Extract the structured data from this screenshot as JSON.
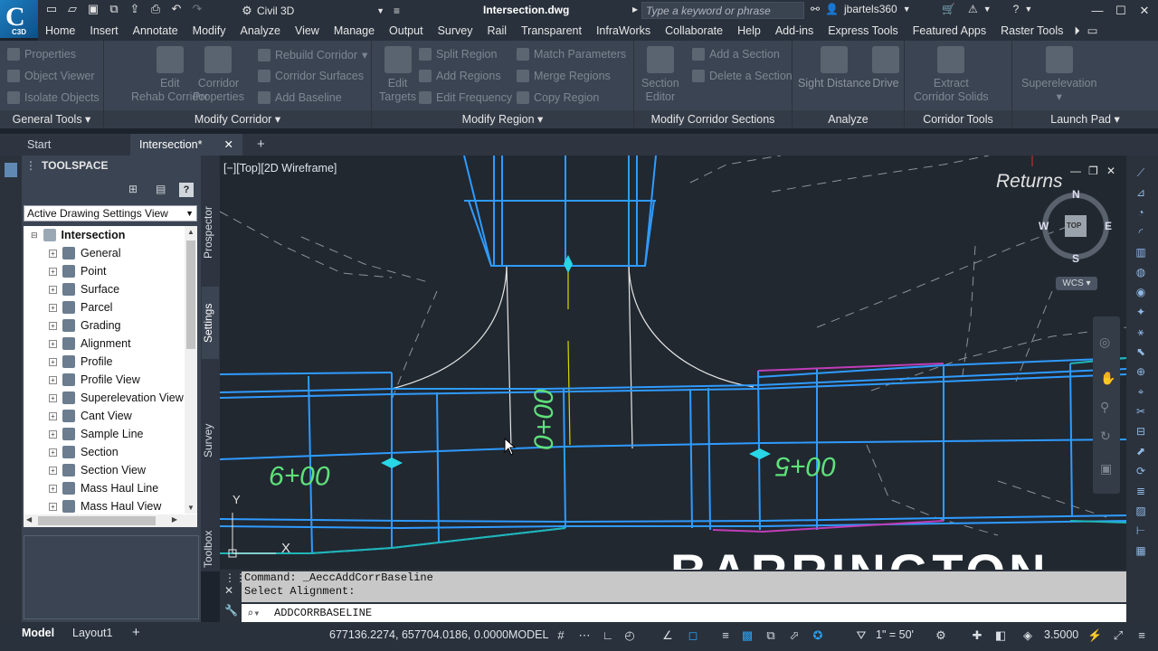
{
  "app": {
    "logo_text": "C",
    "logo_sub": "C3D",
    "workspace": "Civil 3D",
    "document_title": "Intersection.dwg"
  },
  "search": {
    "placeholder": "Type a keyword or phrase"
  },
  "user": {
    "name": "jbartels360"
  },
  "ribbon_tabs": [
    "Home",
    "Insert",
    "Annotate",
    "Modify",
    "Analyze",
    "View",
    "Manage",
    "Output",
    "Survey",
    "Rail",
    "Transparent",
    "InfraWorks",
    "Collaborate",
    "Help",
    "Add-ins",
    "Express Tools",
    "Featured Apps",
    "Raster Tools"
  ],
  "ribbon": {
    "general_tools": {
      "title": "General Tools",
      "properties": "Properties",
      "object_viewer": "Object Viewer",
      "isolate_objects": "Isolate Objects"
    },
    "modify_corridor": {
      "title": "Modify Corridor",
      "edit_rehab_l1": "Edit",
      "edit_rehab_l2": "Rehab Corridor",
      "corridor_props_l1": "Corridor",
      "corridor_props_l2": "Properties",
      "rebuild": "Rebuild Corridor",
      "surfaces": "Corridor Surfaces",
      "add_baseline": "Add Baseline"
    },
    "modify_region": {
      "title": "Modify Region",
      "edit_targets_l1": "Edit",
      "edit_targets_l2": "Targets",
      "split": "Split Region",
      "add_regions": "Add Regions",
      "edit_frequency": "Edit Frequency",
      "match_params": "Match Parameters",
      "merge": "Merge Regions",
      "copy": "Copy Region"
    },
    "modify_sections": {
      "title": "Modify Corridor Sections",
      "section_editor_l1": "Section",
      "section_editor_l2": "Editor",
      "add_section": "Add a Section",
      "delete_section": "Delete a Section"
    },
    "analyze": {
      "title": "Analyze",
      "sight_distance": "Sight Distance",
      "drive": "Drive"
    },
    "corridor_tools": {
      "title": "Corridor Tools",
      "extract_l1": "Extract",
      "extract_l2": "Corridor Solids"
    },
    "launch_pad": {
      "title": "Launch Pad",
      "superelevation": "Superelevation"
    }
  },
  "doc_tabs": {
    "start": "Start",
    "active": "Intersection*"
  },
  "toolspace": {
    "title": "TOOLSPACE",
    "view_select": "Active Drawing Settings View",
    "root": "Intersection",
    "items": [
      "General",
      "Point",
      "Surface",
      "Parcel",
      "Grading",
      "Alignment",
      "Profile",
      "Profile View",
      "Superelevation View",
      "Cant View",
      "Sample Line",
      "Section",
      "Section View",
      "Mass Haul Line",
      "Mass Haul View"
    ],
    "vertical_tabs": [
      "Prospector",
      "Settings",
      "Survey",
      "Toolbox"
    ]
  },
  "canvas": {
    "viewport_label": "[−][Top][2D Wireframe]",
    "annotation": "Returns",
    "compass": {
      "n": "N",
      "s": "S",
      "e": "E",
      "w": "W",
      "top": "TOP"
    },
    "wcs": "WCS",
    "stations": [
      "00+9",
      "0+00",
      "00+5"
    ],
    "street_text": "BARRINGTON",
    "ucs_y": "Y",
    "ucs_x": "X"
  },
  "command": {
    "history": [
      "Command: _AeccAddCorrBaseline",
      "Select Alignment:"
    ],
    "input": "ADDCORRBASELINE"
  },
  "status": {
    "model_tab": "Model",
    "layout_tab": "Layout1",
    "coordinates": "677136.2274, 657704.0186, 0.0000",
    "mode": "MODEL",
    "scale": "1\" = 50'",
    "elevation": "3.5000"
  },
  "colors": {
    "corridor_blue": "#2f9bff",
    "station_green": "#5fe07a",
    "centerline_yellow": "#d8d800",
    "edge_magenta": "#c03db8",
    "edge_cyan": "#1fb6b6"
  }
}
